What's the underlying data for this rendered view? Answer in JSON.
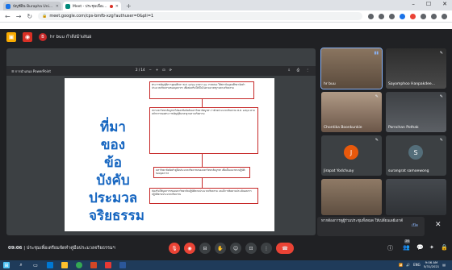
{
  "browser": {
    "tabs": [
      {
        "label": "บัญชีอิน Burapha University - Sutm",
        "active": false,
        "favicon_color": "#1a73e8"
      },
      {
        "label": "Meet - ประชุมเพื่อเตรียมจัดทำ",
        "active": true,
        "favicon_color": "#00897b"
      }
    ],
    "new_tab": "+",
    "window_controls": [
      "–",
      "☐",
      "✕"
    ],
    "url": "meet.google.com/cps-bmfb-xzg?authuser=0&pli=1",
    "extension_colors": [
      "#5f6368",
      "#5f6368",
      "#5f6368",
      "#1a73e8",
      "#ea4335",
      "#5f6368",
      "#5f6368",
      "#5f6368"
    ]
  },
  "meet_header": {
    "presenter_initial": "B",
    "presenter_label": "hr buu กำลังนำเสนอ"
  },
  "presentation": {
    "toolbar_label": "การนำเสนอ PowerPoint",
    "page_indicator": "2 / 14",
    "slide": {
      "title_lines": [
        "ที่มาของ",
        "ข้อบังคับ",
        "ประมวล",
        "จริยธรรม"
      ],
      "boxes": [
        "พระราชบัญญัติการอุดมศึกษา พ.ศ. ๒๕๖๒ มาตรา ๒๒ วรรคสอง ให้สถาบันอุดมศึกษาจัดทำประมวลจริยธรรมของบุคลากร เพื่อส่งเสริมให้เป็นไปตามมาตรฐานทางจริยธรรม",
        "สภามหาวิทยาลัยบูรพาได้ออกข้อบังคับมหาวิทยาลัยบูรพา ว่าด้วยประมวลจริยธรรม พ.ศ. ๒๕๖๔ ตามหลักการของพระราชบัญญัติมาตรฐานทางจริยธรรม",
        "มหาวิทยาลัยจัดทำคู่มือประมวลจริยธรรมของมหาวิทยาลัยบูรพา เพื่อเป็นแนวทางปฏิบัติของบุคลากร",
        "ส่งเสริมให้บุคลากรของมหาวิทยาลัยปฏิบัติตามประมวลจริยธรรม และมีการติดตามประเมินผลการปฏิบัติตามประมวลจริยธรรม"
      ]
    }
  },
  "participants": [
    {
      "name": "hr buu",
      "type": "photo",
      "color": "#6d5a4a",
      "speaking": true
    },
    {
      "name": "Sayomphoo Hanpakdee...",
      "type": "photo",
      "color": "#3a3a3a",
      "speaking": false
    },
    {
      "name": "Chontika Boonkunkie",
      "type": "photo",
      "color": "#8b6f5a",
      "speaking": false
    },
    {
      "name": "Pornchan Pothak",
      "type": "photo",
      "color": "#505458",
      "speaking": false
    },
    {
      "name": "Jirapat Yodchuay",
      "type": "avatar",
      "initial": "J",
      "color": "#e8590c",
      "speaking": false
    },
    {
      "name": "surangrat samoewong",
      "type": "avatar",
      "initial": "S",
      "color": "#546e7a",
      "speaking": false
    },
    {
      "name": "",
      "type": "photo",
      "color": "#77624f",
      "speaking": false
    },
    {
      "name": "",
      "type": "photo",
      "color": "#4a4e52",
      "speaking": false
    }
  ],
  "notification": {
    "text": "หากต้องการดูผู้ร่วมประชุมทั้งหมด ให้เปลี่ยนเลย์เอาต์",
    "action": "เปิด",
    "close": "✕"
  },
  "controls": {
    "time": "09:06",
    "meeting_title": "ประชุมเพื่อเตรียมจัดทำคู่มือประมวลจริยธรรมฯ",
    "participants_count": "26",
    "icons": {
      "mic": "🎙",
      "camera": "◉",
      "captions": "⊟",
      "hand": "✋",
      "emoji": "☺",
      "present": "⊡",
      "more": "⋮",
      "end": "☎",
      "info": "ⓘ",
      "people": "👥",
      "chat": "💬",
      "activities": "✦",
      "lock": "🔒"
    }
  },
  "taskbar": {
    "clock_time": "9:06 AM",
    "clock_date": "5/31/2021",
    "lang": "ENG"
  }
}
